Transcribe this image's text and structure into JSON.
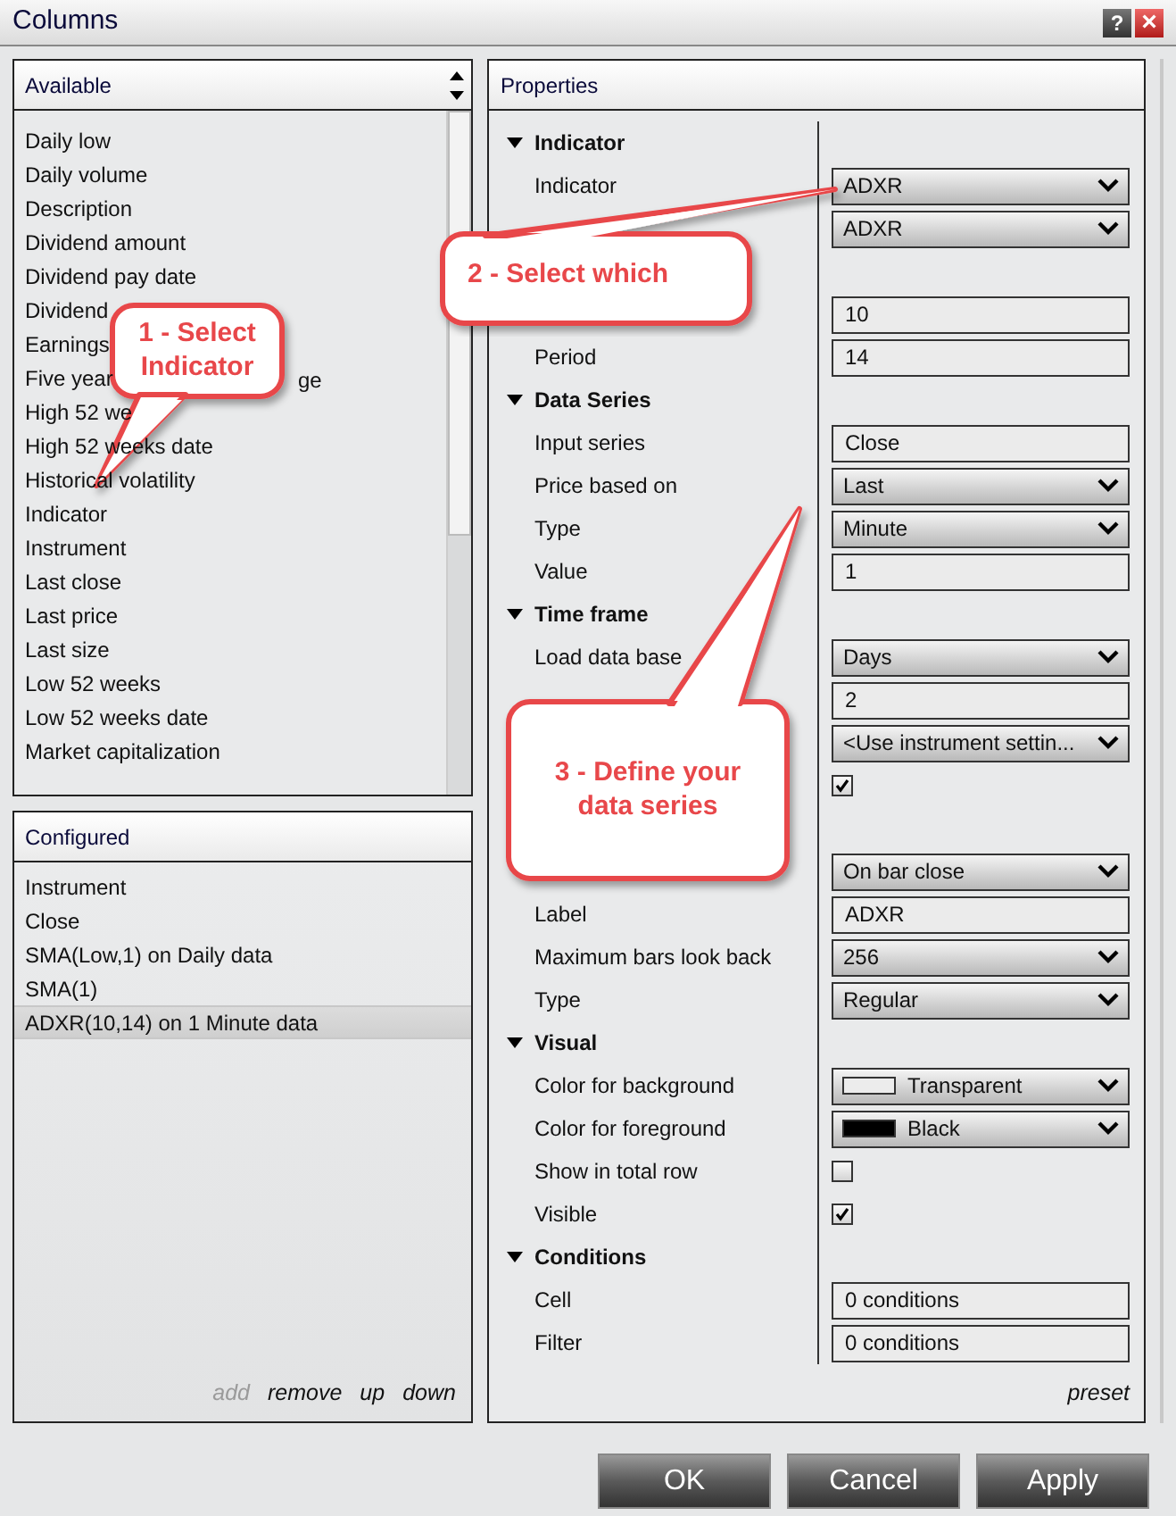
{
  "window": {
    "title": "Columns",
    "help_button": "?",
    "close_button": "×"
  },
  "available": {
    "title": "Available",
    "items": [
      {
        "label": "Daily low"
      },
      {
        "label": "Daily volume"
      },
      {
        "label": "Description"
      },
      {
        "label": "Dividend amount"
      },
      {
        "label": "Dividend pay date"
      },
      {
        "label": "Dividend"
      },
      {
        "label": "Earnings"
      },
      {
        "label": "Five year",
        "tail": "ge"
      },
      {
        "label": "High 52 we"
      },
      {
        "label": "High 52 weeks date"
      },
      {
        "label": "Historical volatility"
      },
      {
        "label": "Indicator"
      },
      {
        "label": "Instrument"
      },
      {
        "label": "Last close"
      },
      {
        "label": "Last price"
      },
      {
        "label": "Last size"
      },
      {
        "label": "Low 52 weeks"
      },
      {
        "label": "Low 52 weeks date"
      },
      {
        "label": "Market capitalization"
      }
    ]
  },
  "configured": {
    "title": "Configured",
    "items": [
      {
        "label": "Instrument",
        "selected": false
      },
      {
        "label": "Close",
        "selected": false
      },
      {
        "label": "SMA(Low,1) on Daily data",
        "selected": false
      },
      {
        "label": "SMA(1)",
        "selected": false
      },
      {
        "label": "ADXR(10,14) on 1 Minute data",
        "selected": true
      }
    ],
    "actions": [
      {
        "label": "add",
        "disabled": true
      },
      {
        "label": "remove",
        "disabled": false
      },
      {
        "label": "up",
        "disabled": false
      },
      {
        "label": "down",
        "disabled": false
      }
    ]
  },
  "properties": {
    "title": "Properties",
    "rows": [
      {
        "kind": "header",
        "label": "Indicator"
      },
      {
        "kind": "dropdown",
        "label": "Indicator",
        "value": "ADXR"
      },
      {
        "kind": "dropdown",
        "value": "ADXR"
      },
      {
        "kind": "blank"
      },
      {
        "kind": "field",
        "value": "10"
      },
      {
        "kind": "field",
        "label": "Period",
        "value": "14"
      },
      {
        "kind": "header",
        "label": "Data Series"
      },
      {
        "kind": "field",
        "label": "Input series",
        "value": "Close"
      },
      {
        "kind": "dropdown",
        "label": "Price based on",
        "value": "Last"
      },
      {
        "kind": "dropdown",
        "label": "Type",
        "value": "Minute"
      },
      {
        "kind": "field",
        "label": "Value",
        "value": "1"
      },
      {
        "kind": "header",
        "label": "Time frame"
      },
      {
        "kind": "dropdown",
        "label": "Load data base",
        "value": "Days"
      },
      {
        "kind": "field",
        "value": "2"
      },
      {
        "kind": "dropdown",
        "value": "<Use instrument settin..."
      },
      {
        "kind": "checkbox",
        "checked": true
      },
      {
        "kind": "blank"
      },
      {
        "kind": "dropdown",
        "value": "On bar close"
      },
      {
        "kind": "field",
        "label": "Label",
        "value": "ADXR"
      },
      {
        "kind": "dropdown",
        "label": "Maximum bars look back",
        "value": "256"
      },
      {
        "kind": "dropdown",
        "label": "Type",
        "value": "Regular"
      },
      {
        "kind": "header",
        "label": "Visual"
      },
      {
        "kind": "color",
        "label": "Color for background",
        "value": "Transparent",
        "color": "#ececec"
      },
      {
        "kind": "color",
        "label": "Color for foreground",
        "value": "Black",
        "color": "#000000"
      },
      {
        "kind": "checkbox",
        "label": "Show in total row",
        "checked": false
      },
      {
        "kind": "checkbox",
        "label": "Visible",
        "checked": true
      },
      {
        "kind": "header",
        "label": "Conditions"
      },
      {
        "kind": "field",
        "label": "Cell",
        "value": "0 conditions"
      },
      {
        "kind": "field",
        "label": "Filter",
        "value": "0 conditions"
      }
    ],
    "preset": "preset"
  },
  "buttons": [
    "OK",
    "Cancel",
    "Apply"
  ],
  "callouts": [
    {
      "lines": [
        "1 - Select",
        "Indicator"
      ]
    },
    {
      "lines": [
        "2 - Select which"
      ]
    },
    {
      "lines": [
        "3 - Define your",
        "data series"
      ]
    }
  ]
}
